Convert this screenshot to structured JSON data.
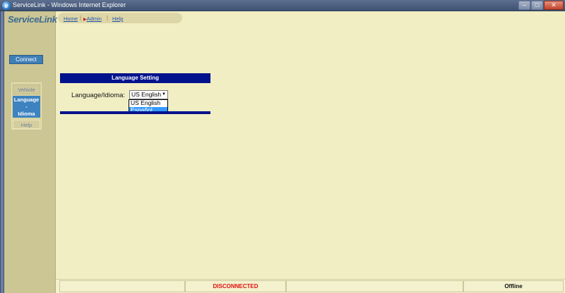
{
  "window": {
    "title": "ServiceLink - Windows Internet Explorer"
  },
  "logo": "ServiceLink",
  "nav": {
    "home": "Home",
    "admin": "Admin",
    "help": "Help"
  },
  "sidebar": {
    "connect": "Connect",
    "items": [
      {
        "label": "Vehicle"
      },
      {
        "label": "Language - Idioma"
      },
      {
        "label": "Help"
      }
    ]
  },
  "language": {
    "header": "Language Setting",
    "label": "Language/Idioma:",
    "selected": "US English",
    "options": [
      "US English",
      "Español"
    ]
  },
  "status": {
    "connection": "DISCONNECTED",
    "mode": "Offline"
  },
  "colors": {
    "header_bg": "#00128c",
    "selected_option": "#3399ff",
    "disconnected": "#e01010"
  }
}
